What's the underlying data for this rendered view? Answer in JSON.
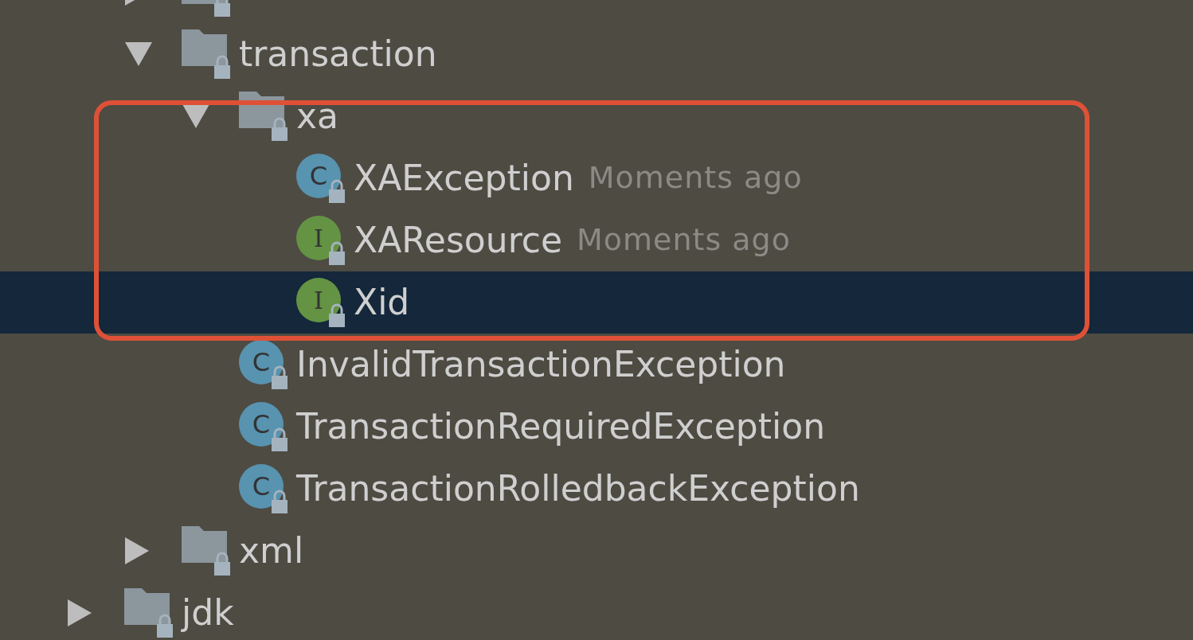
{
  "tree": [
    {
      "children": [
        {
          "kind": "folder",
          "expanded": false,
          "selected": false
        },
        {
          "kind": "folder",
          "name": "transaction",
          "expanded": true,
          "selected": false,
          "children": [
            {
              "kind": "folder",
              "name": "xa",
              "expanded": true,
              "selected": false,
              "children": [
                {
                  "kind": "class",
                  "badge": "C",
                  "name": "XAException",
                  "time": "Moments ago",
                  "selected": false
                },
                {
                  "kind": "interface",
                  "badge": "I",
                  "name": "XAResource",
                  "time": "Moments ago",
                  "selected": false
                },
                {
                  "kind": "interface",
                  "badge": "I",
                  "name": "Xid",
                  "selected": true
                }
              ]
            },
            {
              "kind": "class",
              "badge": "C",
              "name": "InvalidTransactionException",
              "selected": false
            },
            {
              "kind": "class",
              "badge": "C",
              "name": "TransactionRequiredException",
              "selected": false
            },
            {
              "kind": "class",
              "badge": "C",
              "name": "TransactionRolledbackException",
              "selected": false
            }
          ]
        },
        {
          "kind": "folder",
          "name": "xml",
          "expanded": false,
          "selected": false
        }
      ]
    },
    {
      "kind": "folder",
      "name": "jdk",
      "expanded": false,
      "selected": false
    }
  ]
}
